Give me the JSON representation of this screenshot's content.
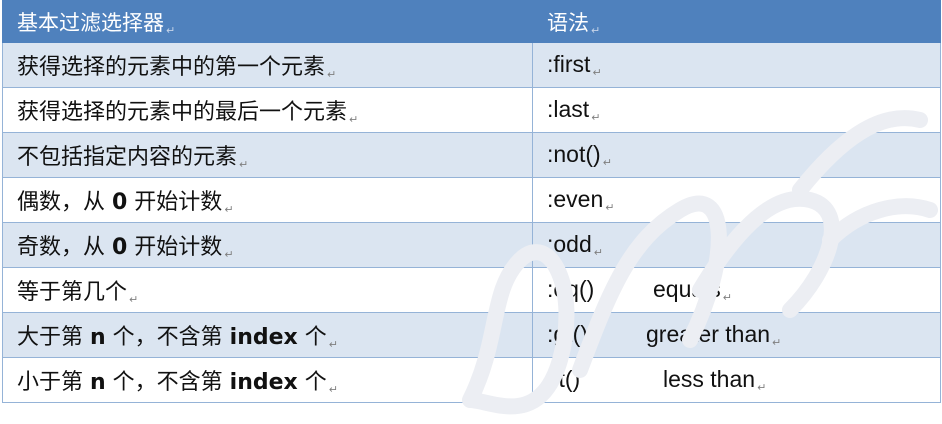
{
  "table": {
    "header": {
      "name": "基本过滤选择器",
      "syntax": "语法"
    },
    "rows": [
      {
        "name": [
          "获得选择的元素中的第一个元素"
        ],
        "code": ":first",
        "meaning": ""
      },
      {
        "name": [
          "获得选择的元素中的最后一个元素"
        ],
        "code": ":last",
        "meaning": ""
      },
      {
        "name": [
          "不包括指定内容的元素"
        ],
        "code": ":not()",
        "meaning": ""
      },
      {
        "name": [
          "偶数，从 ",
          "0",
          " 开始计数"
        ],
        "code": ":even",
        "meaning": ""
      },
      {
        "name": [
          "奇数，从 ",
          "0",
          " 开始计数"
        ],
        "code": ":odd",
        "meaning": ""
      },
      {
        "name": [
          "等于第几个"
        ],
        "code": ":eq()",
        "meaning": "equals"
      },
      {
        "name": [
          "大于第 ",
          "n",
          " 个，不含第 ",
          "index",
          " 个"
        ],
        "code": ":gt()",
        "meaning": "greater than"
      },
      {
        "name": [
          "小于第 ",
          "n",
          " 个，不含第 ",
          "index",
          " 个"
        ],
        "code": ":lt()",
        "meaning": "less than"
      }
    ]
  },
  "paragraph_mark": "↵",
  "colors": {
    "header_bg": "#4f81bd",
    "band_bg": "#dbe5f1",
    "border": "#95b3d7"
  }
}
